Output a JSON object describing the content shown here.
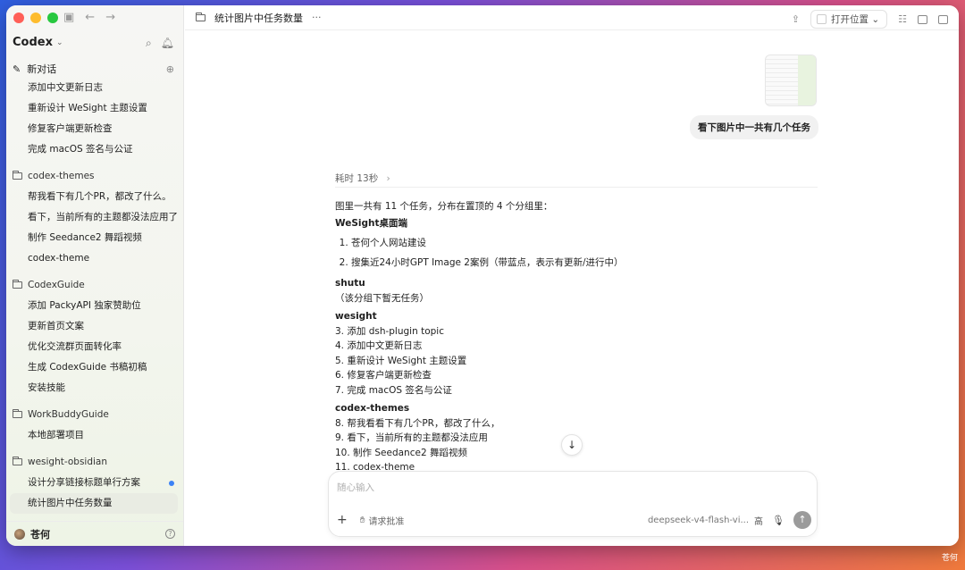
{
  "window": {
    "title": "统计图片中任务数量",
    "more": "···"
  },
  "sidebar": {
    "brand": "Codex",
    "new_chat": "新对话",
    "items_top": [
      {
        "label": "添加中文更新日志"
      },
      {
        "label": "重新设计 WeSight 主题设置"
      },
      {
        "label": "修复客户端更新检查"
      },
      {
        "label": "完成 macOS 签名与公证"
      }
    ],
    "groups": [
      {
        "name": "codex-themes",
        "items": [
          {
            "label": "帮我看下有几个PR，都改了什么。"
          },
          {
            "label": "看下，当前所有的主题都没法应用了"
          },
          {
            "label": "制作 Seedance2 舞蹈视频"
          },
          {
            "label": "codex-theme"
          }
        ]
      },
      {
        "name": "CodexGuide",
        "items": [
          {
            "label": "添加 PackyAPI 独家赞助位"
          },
          {
            "label": "更新首页文案"
          },
          {
            "label": "优化交流群页面转化率"
          },
          {
            "label": "生成 CodexGuide 书稿初稿"
          },
          {
            "label": "安装技能"
          }
        ]
      },
      {
        "name": "WorkBuddyGuide",
        "items": [
          {
            "label": "本地部署项目"
          }
        ]
      },
      {
        "name": "wesight-obsidian",
        "items": [
          {
            "label": "设计分享链接标题单行方案"
          },
          {
            "label": "统计图片中任务数量"
          }
        ]
      }
    ],
    "user": "苍何"
  },
  "topbar": {
    "open_position": "打开位置"
  },
  "chat": {
    "user_message": "看下图片中一共有几个任务",
    "thinking": "耗时 13秒",
    "answer": {
      "intro": "图里一共有 11 个任务，分布在置顶的 4 个分组里：",
      "g1_title": "WeSight桌面端",
      "g1_items": [
        "苍何个人网站建设",
        "搜集近24小时GPT Image 2案例（带蓝点，表示有更新/进行中）"
      ],
      "g2_title": "shutu",
      "g2_note": "（该分组下暂无任务）",
      "g3_title": "wesight",
      "g3_lines": [
        "3. 添加 dsh-plugin topic",
        "4. 添加中文更新日志",
        "5. 重新设计 WeSight 主题设置",
        "6. 修复客户端更新检查",
        "7. 完成 macOS 签名与公证"
      ],
      "g4_title": "codex-themes",
      "g4_lines": [
        "8. 帮我看看下有几个PR，都改了什么，",
        "9. 看下，当前所有的主题都没法应用",
        "10. 制作 Seedance2 舞蹈视频",
        "11. codex-theme"
      ]
    }
  },
  "composer": {
    "placeholder": "随心输入",
    "approve": "请求批准",
    "model": "deepseek-v4-flash-vi...",
    "level": "高"
  },
  "watermark": "苍何"
}
